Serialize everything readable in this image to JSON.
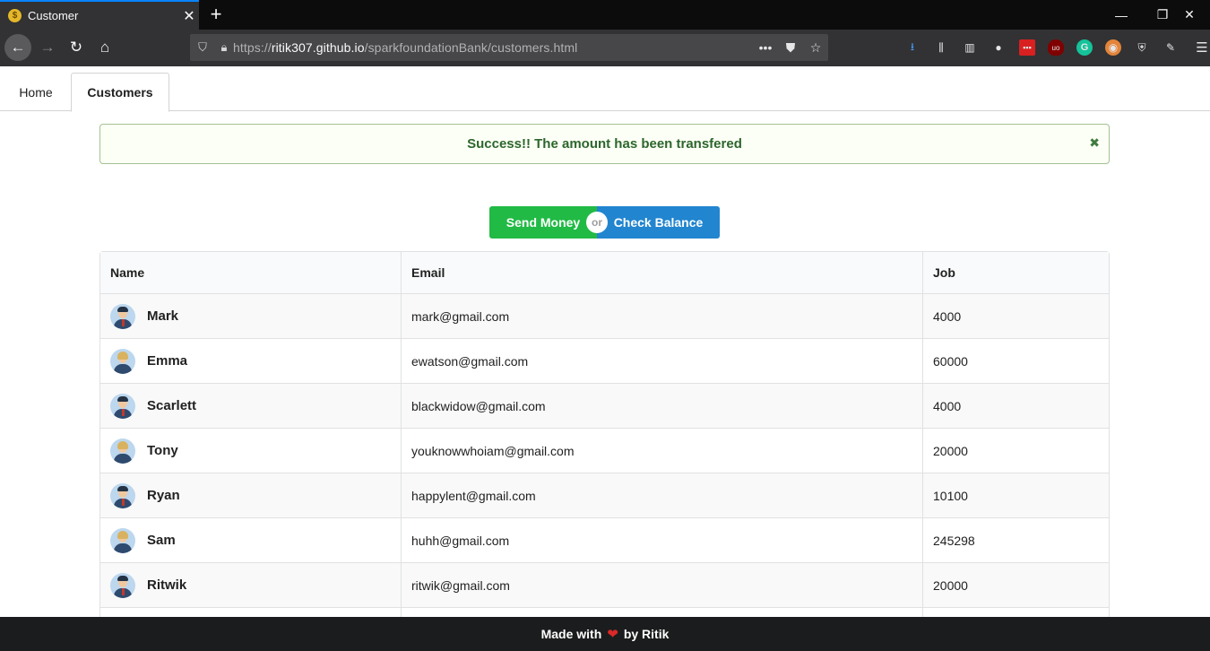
{
  "browser": {
    "tab_title": "Customer",
    "url_prefix": "https://",
    "url_domain": "ritik307.github.io",
    "url_path": "/sparkfoundationBank/customers.html",
    "icons": [
      "back-icon",
      "forward-icon",
      "reload-icon",
      "home-icon",
      "shield-icon",
      "lock-icon",
      "more-icon",
      "pocket-icon",
      "star-icon",
      "download-icon",
      "library-icon",
      "sidebar-icon",
      "account-icon",
      "menu-icon"
    ]
  },
  "nav": {
    "home": "Home",
    "customers": "Customers"
  },
  "alert": {
    "message": "Success!! The amount has been transfered",
    "close": "✖"
  },
  "actions": {
    "send": "Send Money",
    "or": "or",
    "check": "Check Balance"
  },
  "table": {
    "headers": [
      "Name",
      "Email",
      "Job"
    ],
    "rows": [
      {
        "name": "Mark",
        "email": "mark@gmail.com",
        "job": "4000",
        "avatar": "male"
      },
      {
        "name": "Emma",
        "email": "ewatson@gmail.com",
        "job": "60000",
        "avatar": "female"
      },
      {
        "name": "Scarlett",
        "email": "blackwidow@gmail.com",
        "job": "4000",
        "avatar": "male"
      },
      {
        "name": "Tony",
        "email": "youknowwhoiam@gmail.com",
        "job": "20000",
        "avatar": "female"
      },
      {
        "name": "Ryan",
        "email": "happylent@gmail.com",
        "job": "10100",
        "avatar": "male"
      },
      {
        "name": "Sam",
        "email": "huhh@gmail.com",
        "job": "245298",
        "avatar": "female"
      },
      {
        "name": "Ritwik",
        "email": "ritwik@gmail.com",
        "job": "20000",
        "avatar": "male"
      }
    ]
  },
  "footer": {
    "before": "Made with",
    "heart": "❤",
    "after": "by Ritik"
  }
}
